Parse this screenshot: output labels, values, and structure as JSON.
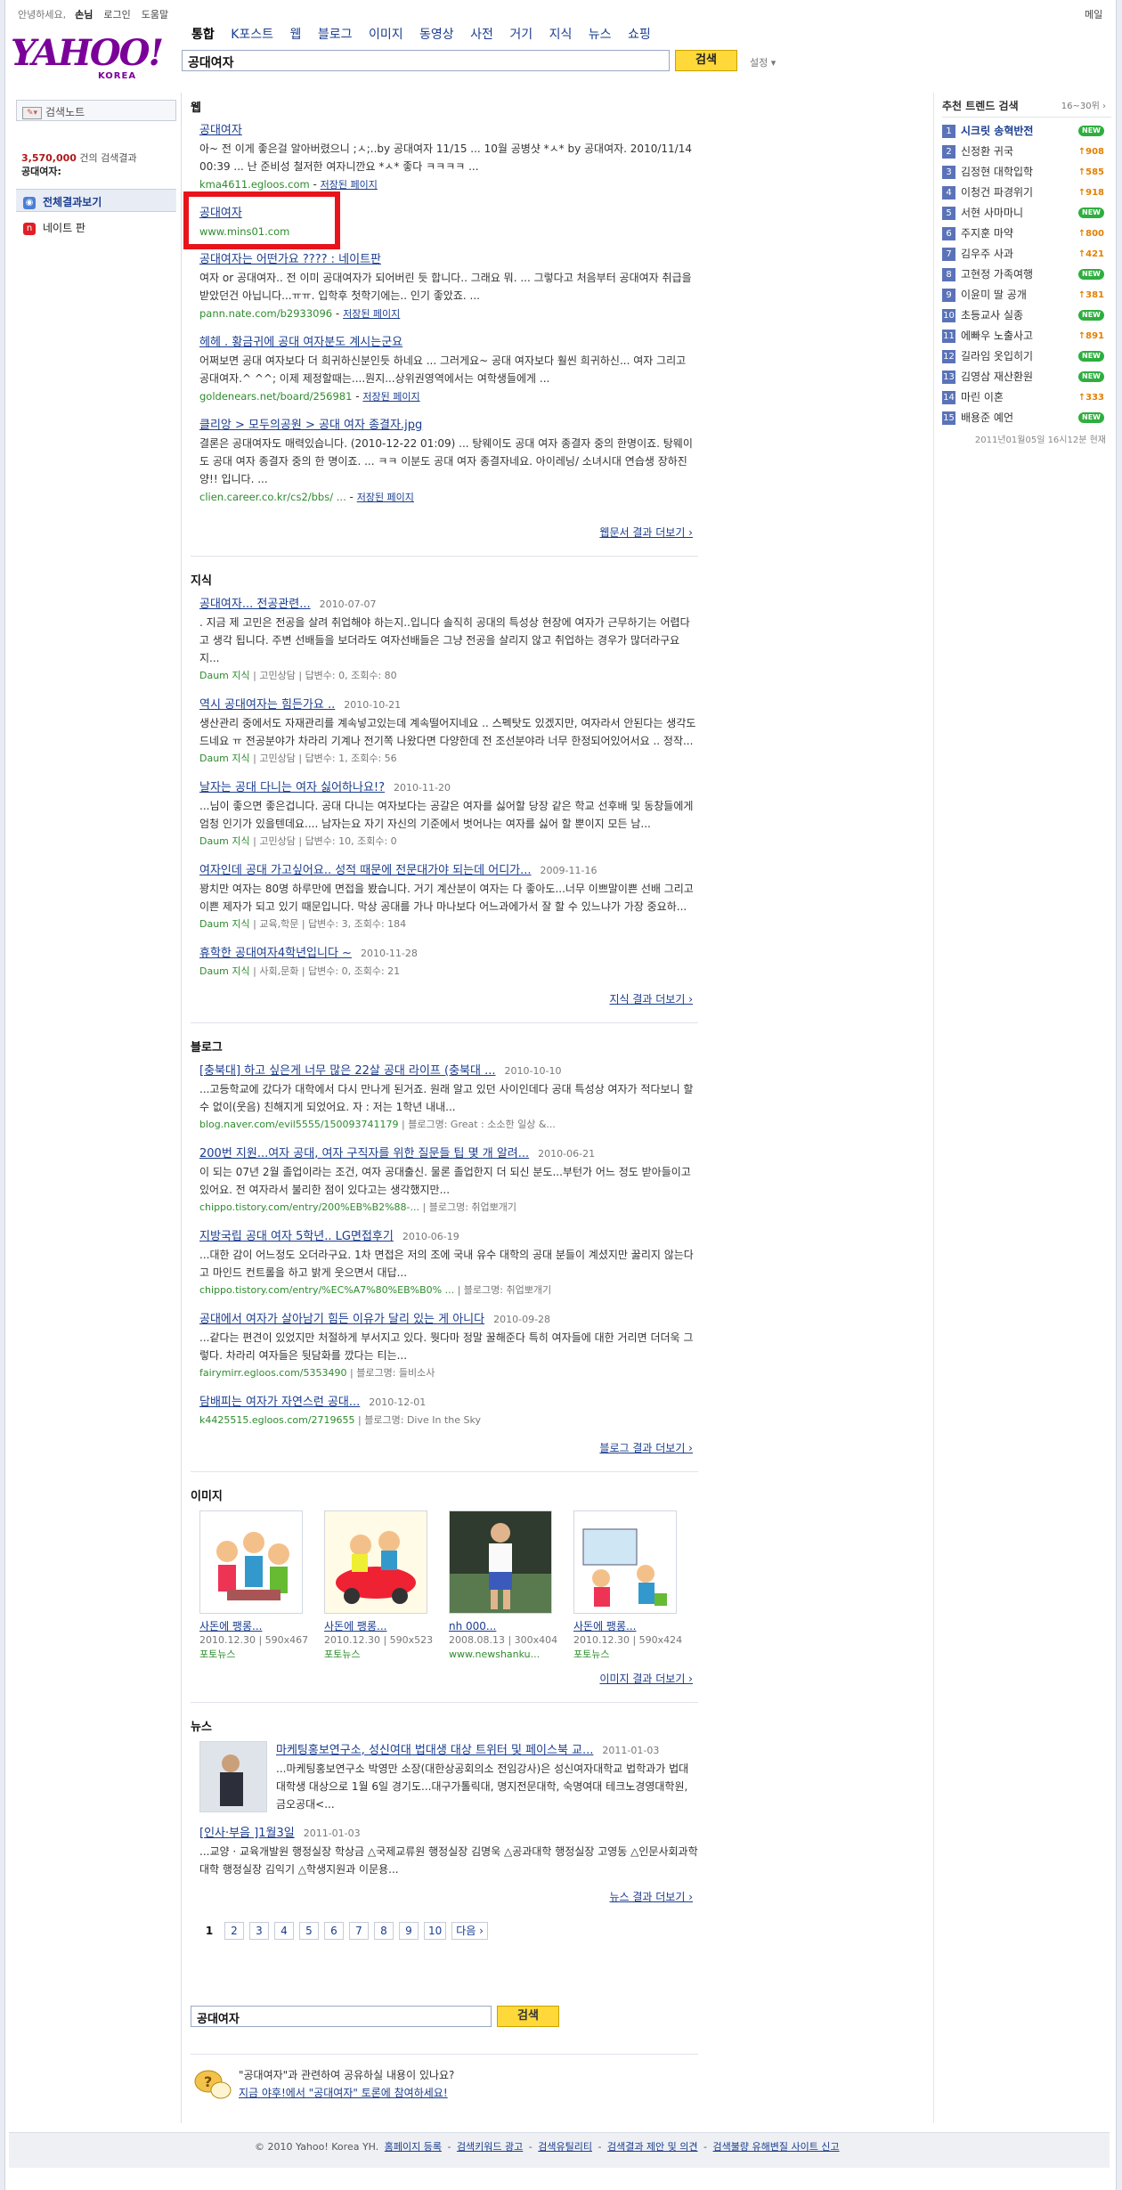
{
  "topbar": {
    "greeting": "안녕하세요,",
    "user": "손님",
    "login": "로그인",
    "help": "도움말",
    "mail": "메일"
  },
  "logo": {
    "text": "YAHOO!",
    "sub": "KOREA"
  },
  "tabs": [
    "통합",
    "K포스트",
    "웹",
    "블로그",
    "이미지",
    "동영상",
    "사전",
    "거기",
    "지식",
    "뉴스",
    "쇼핑"
  ],
  "search": {
    "query": "공대여자",
    "button": "검색",
    "settings": "설정 ▾"
  },
  "sidebar": {
    "notebook": "검색노트",
    "count_num": "3,570,000",
    "count_text": " 건의 검색결과",
    "count_query": "공대여자:",
    "nav": [
      {
        "label": "전체결과보기"
      },
      {
        "label": "네이트 판"
      }
    ]
  },
  "web": {
    "title": "웹",
    "results": [
      {
        "title": "공대여자",
        "snippet": "아~ 전 이게 좋은걸 알아버렸으니 ;ㅅ;..by 공대여자 11/15 ... 10월 공병샷 *ㅅ* by 공대여자. 2010/11/14 00:39 ... 난 준비성 철저한 여자니깐요 *ㅅ* 좋다 ㅋㅋㅋㅋ ...",
        "url": "kma4611.egloos.com",
        "cache": "저장된 페이지"
      },
      {
        "title": "공대여자",
        "snippet": "",
        "url": "www.mins01.com",
        "cache": ""
      },
      {
        "title": "공대여자는 어떤가요 ???? : 네이트판",
        "snippet": "여자 or 공대여자.. 전 이미 공대여자가 되어버린 듯 합니다.. 그래요 뭐. ... 그렇다고 처음부터 공대여자 취급을 받았던건 아닙니다...ㅠㅠ. 입학후 첫학기에는.. 인기 좋았죠. ...",
        "url": "pann.nate.com/b2933096",
        "cache": "저장된 페이지"
      },
      {
        "title": "헤헤 . 황금귀에 공대 여자분도 계시는군요",
        "snippet": "어쩌보면 공대 여자보다 더 희귀하신분인듯 하네요 ... 그러게요~ 공대 여자보다 훨씬 희귀하신... 여자 그리고 공대여자.^ ^^; 이제 제정할때는....뭔지...상위권영역에서는 여학생들에게 ...",
        "url": "goldenears.net/board/256981",
        "cache": "저장된 페이지"
      },
      {
        "title": "클리앙 > 모두의공원 > 공대 여자 종결자.jpg",
        "snippet": "결론은 공대여자도 매력있습니다. (2010-12-22 01:09) ... 탕웨이도 공대 여자 종결자 중의 한명이죠. 탕웨이도 공대 여자 종결자 중의 한 명이죠. ... ㅋㅋ 이분도 공대 여자 종결자네요. 아이레닝/ 소녀시대 연습생 장하진양!! 입니다. ...",
        "url": "clien.career.co.kr/cs2/bbs/ ...",
        "cache": "저장된 페이지"
      }
    ],
    "more": "웹문서 결과 더보기 ›"
  },
  "jisik": {
    "title": "지식",
    "results": [
      {
        "title": "공대여자... 전공관련...",
        "date": "2010-07-07",
        "snippet": ". 지금 제 고민은 전공을 살려 취업해야 하는지..입니다 솔직히 공대의 특성상 현장에 여자가 근무하기는 어렵다고 생각 됩니다. 주변 선배들을 보더라도 여자선배들은 그냥 전공을 살리지 않고 취업하는 경우가 많더라구요 지...",
        "src": "Daum 지식",
        "cat": "고민상담",
        "stats": "답변수: 0, 조회수: 80"
      },
      {
        "title": "역시 공대여자는 힘든가요 ..",
        "date": "2010-10-21",
        "snippet": "생산관리 중에서도 자재관리를 계속넣고있는데 계속떨어지네요 .. 스펙탓도 있겠지만, 여자라서 안된다는 생각도 드네요 ㅠ 전공분야가 차라리 기계나 전기쪽 나왔다면 다양한데 전 조선분야라 너무 한정되어있어서요 .. 정작...",
        "src": "Daum 지식",
        "cat": "고민상담",
        "stats": "답변수: 1, 조회수: 56"
      },
      {
        "title": "날자는 공대 다니는 여자 싫어하나요!?",
        "date": "2010-11-20",
        "snippet": "...님이 좋으면 좋은겁니다. 공대 다니는 여자보다는 공갈은 여자를 싫어할 당장 같은 학교 선후배 및 동창들에게 엄청 인기가 있을텐데요.... 남자는요 자기 자신의 기준에서 벗어나는 여자를 싫어 할 뿐이지 모든 남...",
        "src": "Daum 지식",
        "cat": "고민상담",
        "stats": "답변수: 10, 조회수: 0"
      },
      {
        "title": "여자인데 공대 가고싶어요.. 성적 때문에 전문대가야 되는데 어디가...",
        "date": "2009-11-16",
        "snippet": "꽝치만 여자는 80명 하루만에 면접을 봤습니다. 거기 계산분이 여자는 다 좋아도...너무 이쁘말이쁜 선배 그리고 이쁜 제자가 되고 있기 때문입니다. 막상 공대를 가나 마나보다 어느과에가서 잘 할 수 있느냐가 가장 중요하...",
        "src": "Daum 지식",
        "cat": "교육,학문",
        "stats": "답변수: 3, 조회수: 184"
      },
      {
        "title": "휴학한 공대여자4학년입니다 ~",
        "date": "2010-11-28",
        "snippet": "",
        "src": "Daum 지식",
        "cat": "사회,문화",
        "stats": "답변수: 0, 조회수: 21"
      }
    ],
    "more": "지식 결과 더보기 ›"
  },
  "blog": {
    "title": "블로그",
    "results": [
      {
        "title": "[충북대] 하고 싶은게 너무 많은 22살 공대 라이프 (충북대 ...",
        "date": "2010-10-10",
        "snippet": "...고등학교에 갔다가 대학에서 다시 만나게 된거죠. 원래 알고 있던 사이인데다 공대 특성상 여자가 적다보니 할 수 없이(웃음) 친해지게 되었어요. 자 : 저는 1학년 내내...",
        "url": "blog.naver.com/evil5555/150093741179",
        "bname": "블로그명: Great : 소소한 일상 &..."
      },
      {
        "title": "200번 지원...여자 공대, 여자 구직자를 위한 질문들 팁 몇 개 알려...",
        "date": "2010-06-21",
        "snippet": "이 되는 07년 2월 졸업이라는 조건, 여자 공대출신. 물론 졸업한지 더 되신 분도...부턴가 어느 정도 받아들이고 있어요. 전 여자라서 불리한 점이 있다고는 생각했지만...",
        "url": "chippo.tistory.com/entry/200%EB%B2%88-...",
        "bname": "블로그명: 취업뽀개기"
      },
      {
        "title": "지방국립 공대 여자 5학년.. LG면접후기",
        "date": "2010-06-19",
        "snippet": "...대한 감이 어느정도 오더라구요. 1차 면접은 저의 조에 국내 유수 대학의 공대 분들이 계셨지만 꿇리지 않는다고 마인드 컨트롤을 하고 밝게 웃으면서 대답...",
        "url": "chippo.tistory.com/entry/%EC%A7%80%EB%B0% ...",
        "bname": "블로그명: 취업뽀개기"
      },
      {
        "title": "공대에서 여자가 살아남기 힘든 이유가 달리 있는 게 아니다",
        "date": "2010-09-28",
        "snippet": "...같다는 편견이 있었지만 처절하게 부서지고 있다. 뭣다마 정말 꿀해준다 특히 여자들에 대한 거리면 더더욱 그렇다. 차라리 여자들은 뒷담화를 깠다는 티는...",
        "url": "fairymirr.egloos.com/5353490",
        "bname": "블로그명: 들비소사"
      },
      {
        "title": "담배피는 여자가 자연스런 공대...",
        "date": "2010-12-01",
        "snippet": "",
        "url": "k4425515.egloos.com/2719655",
        "bname": "블로그명: Dive In the Sky"
      }
    ],
    "more": "블로그 결과 더보기 ›"
  },
  "images": {
    "title": "이미지",
    "items": [
      {
        "cap": "사돈에 팽롱...",
        "info": "2010.12.30 | 590x467",
        "src": "포토뉴스"
      },
      {
        "cap": "사돈에 팽롱...",
        "info": "2010.12.30 | 590x523",
        "src": "포토뉴스"
      },
      {
        "cap": "nh 000...",
        "info": "2008.08.13 | 300x404",
        "src": "www.newshanku..."
      },
      {
        "cap": "사돈에 팽롱...",
        "info": "2010.12.30 | 590x424",
        "src": "포토뉴스"
      }
    ],
    "more": "이미지 결과 더보기 ›"
  },
  "news": {
    "title": "뉴스",
    "items": [
      {
        "title": "마케팅홍보연구소, 성신여대 법대생 대상 트위터 및 페이스북 교...",
        "date": "2011-01-03",
        "snippet": "...마케팅홍보연구소 박영만 소장(대한상공회의소 전임강사)은 성신여자대학교 법학과가 법대 대학생 대상으로 1월 6일 경기도...대구가톨릭대, 명지전문대학, 숙명여대 테크노경영대학원, 금오공대<..."
      },
      {
        "title": "[인사·부음 ]1월3일",
        "date": "2011-01-03",
        "snippet": "...교양 · 교육개발원 행정실장 학상금 △국제교류원 행정실장 김명욱 △공과대학 행정실장 고영동 △인문사회과학대학 행정실장 김익기 △학생지원과 이문용..."
      }
    ],
    "more": "뉴스 결과 더보기 ›"
  },
  "pager": {
    "pages": [
      "1",
      "2",
      "3",
      "4",
      "5",
      "6",
      "7",
      "8",
      "9",
      "10"
    ],
    "next": "다음 ›"
  },
  "bottom": {
    "query": "공대여자",
    "button": "검색"
  },
  "share": {
    "question": "\"공대여자\"과 관련하여 공유하실 내용이 있나요?",
    "link": "지금 야후!에서 \"공대여자\" 토론에 참여하세요!"
  },
  "footer": {
    "copyright": "© 2010 Yahoo! Korea YH.",
    "links": [
      "홈페이지 등록",
      "검색키워드 광고",
      "검색유틸리티",
      "검색결과 제안 및 의견",
      "검색불량 유해변질 사이트 신고"
    ]
  },
  "trend": {
    "title": "추천 트렌드 검색",
    "range": "16~30위 ›",
    "items": [
      {
        "rank": "1",
        "kw": "시크릿 송혁반전",
        "chg": "NEW"
      },
      {
        "rank": "2",
        "kw": "신정환 귀국",
        "chg": "↑908"
      },
      {
        "rank": "3",
        "kw": "김정현 대학입학",
        "chg": "↑585"
      },
      {
        "rank": "4",
        "kw": "이청건 파경위기",
        "chg": "↑918"
      },
      {
        "rank": "5",
        "kw": "서현 사마마니",
        "chg": "NEW"
      },
      {
        "rank": "6",
        "kw": "주지훈 마약",
        "chg": "↑800"
      },
      {
        "rank": "7",
        "kw": "김우주 사과",
        "chg": "↑421"
      },
      {
        "rank": "8",
        "kw": "고현정 가족여행",
        "chg": "NEW"
      },
      {
        "rank": "9",
        "kw": "이윤미 딸 공개",
        "chg": "↑381"
      },
      {
        "rank": "10",
        "kw": "초등교사 실종",
        "chg": "NEW"
      },
      {
        "rank": "11",
        "kw": "에빠우 노출사고",
        "chg": "↑891"
      },
      {
        "rank": "12",
        "kw": "길라임 옷입히기",
        "chg": "NEW"
      },
      {
        "rank": "13",
        "kw": "김영삼 재산환원",
        "chg": "NEW"
      },
      {
        "rank": "14",
        "kw": "마린 이혼",
        "chg": "↑333"
      },
      {
        "rank": "15",
        "kw": "배용준 예언",
        "chg": "NEW"
      }
    ],
    "time": "2011년01월05일 16시12분 현재"
  }
}
